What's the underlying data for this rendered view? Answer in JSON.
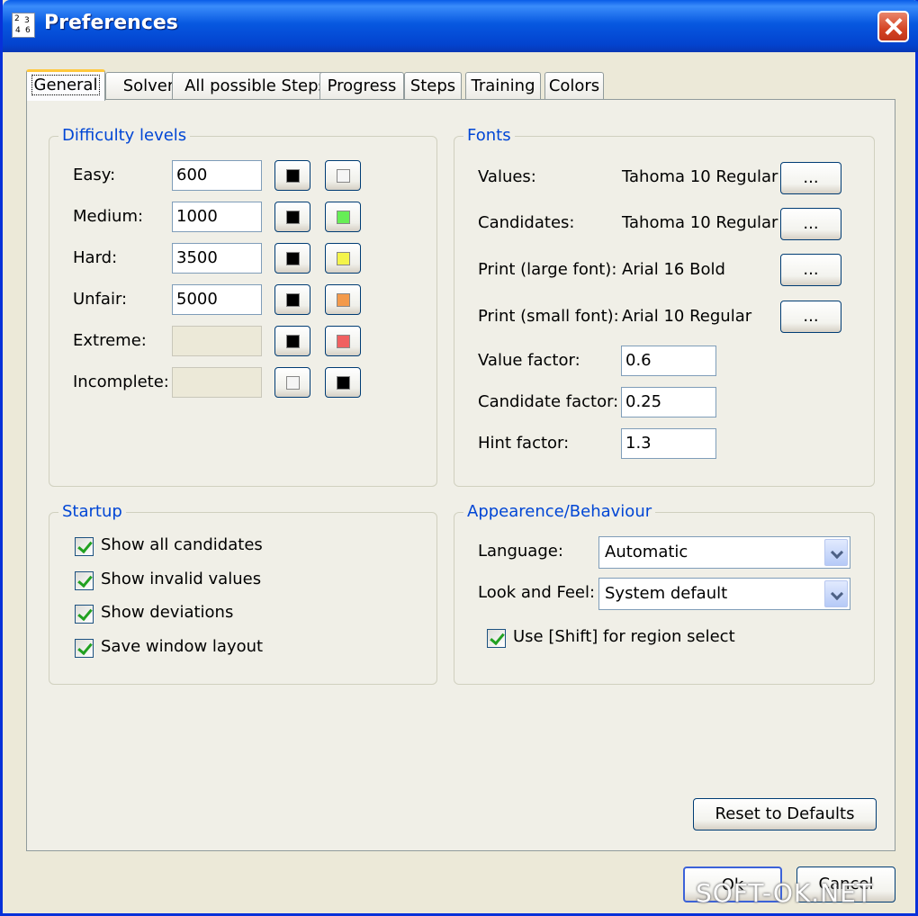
{
  "window": {
    "title": "Preferences",
    "icon_digits": [
      "2",
      "3",
      "4",
      "6"
    ]
  },
  "tabs": [
    {
      "label": "General",
      "active": true
    },
    {
      "label": "Solver"
    },
    {
      "label": "All possible Steps"
    },
    {
      "label": "Progress"
    },
    {
      "label": "Steps"
    },
    {
      "label": "Training"
    },
    {
      "label": "Colors"
    }
  ],
  "difficulty": {
    "title": "Difficulty levels",
    "rows": [
      {
        "label": "Easy:",
        "value": "600",
        "enabled": true,
        "fg": "#000000",
        "bg": "#f5f5f5"
      },
      {
        "label": "Medium:",
        "value": "1000",
        "enabled": true,
        "fg": "#000000",
        "bg": "#66ee55"
      },
      {
        "label": "Hard:",
        "value": "3500",
        "enabled": true,
        "fg": "#000000",
        "bg": "#f4f44a"
      },
      {
        "label": "Unfair:",
        "value": "5000",
        "enabled": true,
        "fg": "#000000",
        "bg": "#f39a4b"
      },
      {
        "label": "Extreme:",
        "value": "",
        "enabled": false,
        "fg": "#000000",
        "bg": "#f06060"
      },
      {
        "label": "Incomplete:",
        "value": "",
        "enabled": false,
        "fg": "#f5f5f5",
        "bg": "#000000"
      }
    ]
  },
  "fonts": {
    "title": "Fonts",
    "rows": [
      {
        "label": "Values:",
        "value": "Tahoma 10 Regular",
        "button": "..."
      },
      {
        "label": "Candidates:",
        "value": "Tahoma 10 Regular",
        "button": "..."
      },
      {
        "label": "Print (large font):",
        "value": "Arial 16 Bold",
        "button": "..."
      },
      {
        "label": "Print (small font):",
        "value": "Arial 10 Regular",
        "button": "..."
      }
    ],
    "factors": [
      {
        "label": "Value factor:",
        "value": "0.6"
      },
      {
        "label": "Candidate factor:",
        "value": "0.25"
      },
      {
        "label": "Hint factor:",
        "value": "1.3"
      }
    ]
  },
  "startup": {
    "title": "Startup",
    "options": [
      {
        "label": "Show all candidates",
        "checked": true
      },
      {
        "label": "Show invalid values",
        "checked": true
      },
      {
        "label": "Show deviations",
        "checked": true
      },
      {
        "label": "Save window layout",
        "checked": true
      }
    ]
  },
  "appearance": {
    "title": "Appearence/Behaviour",
    "language_label": "Language:",
    "language_value": "Automatic",
    "laf_label": "Look and Feel:",
    "laf_value": "System default",
    "shift_label": "Use [Shift] for region select",
    "shift_checked": true
  },
  "buttons": {
    "reset": "Reset to Defaults",
    "ok": "Ok",
    "cancel": "Cancel"
  },
  "watermark": "SOFT-OK.NET",
  "colors": {
    "accent": "#0046d5",
    "titlebar": "#0758e0",
    "window_bg": "#ece9d8"
  }
}
